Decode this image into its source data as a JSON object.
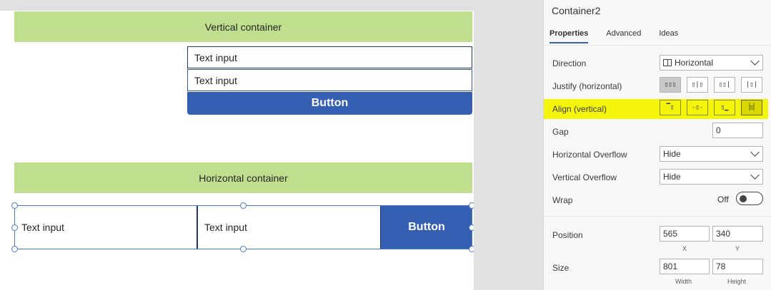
{
  "canvas": {
    "vertical": {
      "header": "Vertical container",
      "inputs": [
        "Text input",
        "Text input"
      ],
      "button": "Button"
    },
    "horizontal": {
      "header": "Horizontal container",
      "inputs": [
        "Text input",
        "Text input"
      ],
      "button": "Button"
    }
  },
  "panel": {
    "title": "Container2",
    "tabs": [
      "Properties",
      "Advanced",
      "Ideas"
    ],
    "active_tab": "Properties",
    "direction": {
      "label": "Direction",
      "value": "Horizontal"
    },
    "justify": {
      "label": "Justify (horizontal)",
      "icons": [
        "justify-start-icon",
        "justify-center-icon",
        "justify-end-icon",
        "justify-space-between-icon"
      ],
      "selected": 0
    },
    "align": {
      "label": "Align (vertical)",
      "icons": [
        "align-top-icon",
        "align-middle-icon",
        "align-bottom-icon",
        "align-stretch-icon"
      ],
      "highlight_color": "#f5f50c"
    },
    "gap": {
      "label": "Gap",
      "value": "0"
    },
    "h_overflow": {
      "label": "Horizontal Overflow",
      "value": "Hide"
    },
    "v_overflow": {
      "label": "Vertical Overflow",
      "value": "Hide"
    },
    "wrap": {
      "label": "Wrap",
      "state": "Off"
    },
    "position": {
      "label": "Position",
      "x": "565",
      "y": "340",
      "x_caption": "X",
      "y_caption": "Y"
    },
    "size": {
      "label": "Size",
      "width": "801",
      "height": "78",
      "width_caption": "Width",
      "height_caption": "Height"
    }
  },
  "colors": {
    "accent": "#355fb2",
    "container_fill": "#bfdf8f",
    "highlight": "#f5f50c"
  }
}
